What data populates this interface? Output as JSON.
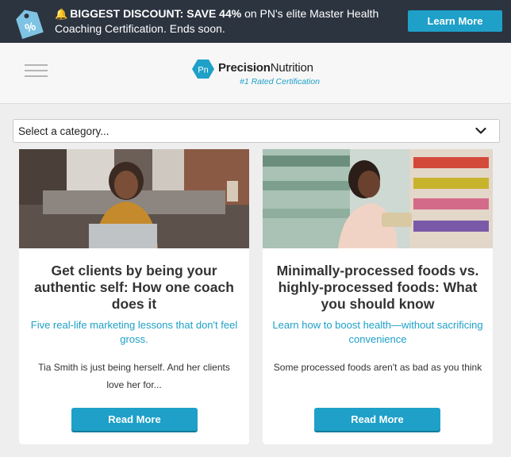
{
  "promo": {
    "bell_icon": "bell-icon",
    "lead_bold": "BIGGEST DISCOUNT: SAVE 44%",
    "text": " on PN's elite Master Health Coaching Certification. Ends soon.",
    "button": "Learn More",
    "tag_symbol": "%"
  },
  "header": {
    "menu_icon": "hamburger-icon",
    "logo_mark": "Pn",
    "logo_name_bold": "Precision",
    "logo_name_rest": "Nutrition",
    "logo_tagline": "#1 Rated Certification"
  },
  "category_select": {
    "selected": "Select a category...",
    "icon": "chevron-down-icon"
  },
  "cards": [
    {
      "title": "Get clients by being your authentic self: How one coach does it",
      "subtitle": "Five real-life marketing lessons that don't feel gross.",
      "excerpt": "Tia Smith is just being herself. And her clients love her for...",
      "button": "Read More"
    },
    {
      "title": "Minimally-processed foods vs. highly-processed foods: What you should know",
      "subtitle": "Learn how to boost health—without sacrificing convenience",
      "excerpt": "Some processed foods aren't as bad as you think",
      "button": "Read More"
    }
  ],
  "colors": {
    "accent": "#1ea0c8",
    "banner_bg": "#2c3440",
    "page_bg": "#eeeeee"
  }
}
